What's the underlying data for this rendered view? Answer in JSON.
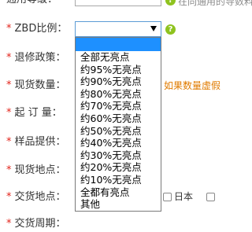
{
  "form": {
    "top_row": {
      "hint": "在同通用的导数料"
    },
    "zbd": {
      "label": "ZBD比例：",
      "required_mark": "*",
      "help": "?",
      "options": [
        "全部无亮点",
        "约95%无亮点",
        "约90%无亮点",
        "约80%无亮点",
        "约70%无亮点",
        "约60%无亮点",
        "约50%无亮点",
        "约40%无亮点",
        "约30%无亮点",
        "约20%无亮点",
        "约10%无亮点",
        "全都有亮点",
        "其他"
      ]
    },
    "return_policy": {
      "label": "退修政策：",
      "required_mark": "*"
    },
    "stock_qty": {
      "label": "现货数量：",
      "required_mark": "*",
      "hint": "如果数量虚假"
    },
    "min_order": {
      "label": "起 订 量：",
      "required_mark": "*"
    },
    "sample": {
      "label": "样品提供：",
      "required_mark": "*"
    },
    "stock_location": {
      "label": "现货地点：",
      "required_mark": "*"
    },
    "delivery_location": {
      "label": "交货地点：",
      "required_mark": "*",
      "checkbox_japan": "日本"
    },
    "delivery_period": {
      "label": "交货周期：",
      "required_mark": "*"
    }
  }
}
